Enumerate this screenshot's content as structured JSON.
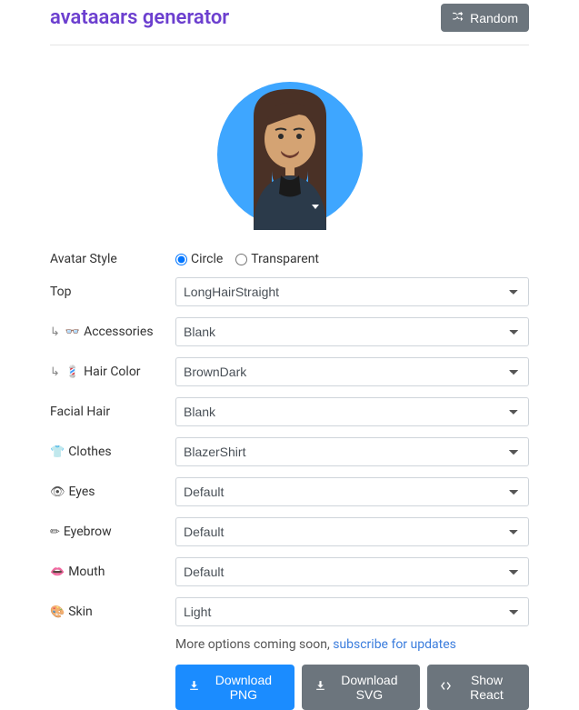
{
  "header": {
    "title": "avataaars generator",
    "random_label": "Random"
  },
  "style_row": {
    "label": "Avatar Style",
    "options": {
      "circle": "Circle",
      "transparent": "Transparent"
    },
    "selected": "circle"
  },
  "rows": [
    {
      "label": "Top",
      "icon": "",
      "sub": "",
      "value": "LongHairStraight"
    },
    {
      "label": "Accessories",
      "icon": "👓",
      "sub": "↳",
      "value": "Blank"
    },
    {
      "label": "Hair Color",
      "icon": "💈",
      "sub": "↳",
      "value": "BrownDark"
    },
    {
      "label": "Facial Hair",
      "icon": "",
      "sub": "",
      "value": "Blank"
    },
    {
      "label": "Clothes",
      "icon": "👕",
      "sub": "",
      "value": "BlazerShirt"
    },
    {
      "label": "Eyes",
      "icon": "👁",
      "sub": "",
      "value": "Default"
    },
    {
      "label": "Eyebrow",
      "icon": "✏",
      "sub": "",
      "value": "Default"
    },
    {
      "label": "Mouth",
      "icon": "👄",
      "sub": "",
      "value": "Default"
    },
    {
      "label": "Skin",
      "icon": "🎨",
      "sub": "",
      "value": "Light"
    }
  ],
  "more": {
    "text": "More options coming soon, ",
    "link": "subscribe for updates"
  },
  "buttons": {
    "png": "Download PNG",
    "svg": "Download SVG",
    "react": "Show React"
  },
  "avatar": {
    "bg": "#3ea6ff",
    "skin": "#d4a373",
    "hair": "#4a3126",
    "shirt": "#2b3a4a"
  }
}
